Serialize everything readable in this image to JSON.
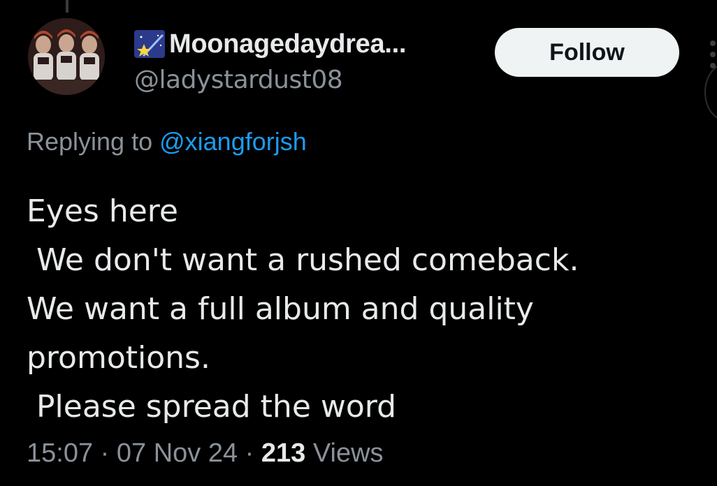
{
  "author": {
    "display_name": "Moonagedaydrea...",
    "name_emoji": "shooting-star-emoji",
    "handle": "@ladystardust08",
    "avatar": "avatar-image"
  },
  "follow_button": {
    "label": "Follow"
  },
  "reply": {
    "prefix": "Replying to ",
    "target": "@xiangforjsh"
  },
  "tweet": {
    "lines": [
      "Eyes here",
      " We don't want a rushed comeback.",
      "We want a full album and quality",
      "promotions.",
      " Please spread the word"
    ]
  },
  "meta": {
    "time": "15:07",
    "separator": " · ",
    "date": "07 Nov 24",
    "views_count": "213",
    "views_label": " Views"
  },
  "colors": {
    "background": "#000000",
    "text": "#e7e9ea",
    "secondary": "#8b9199",
    "link": "#1d9bf0",
    "follow_bg": "#eff3f4"
  }
}
